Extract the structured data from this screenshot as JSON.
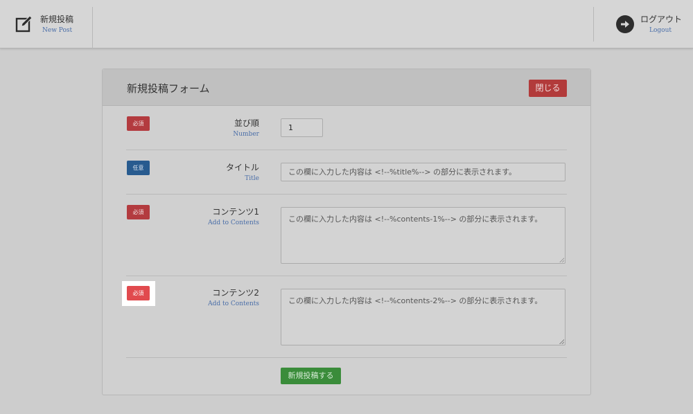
{
  "header": {
    "new_post": {
      "title": "新規投稿",
      "sub": "New Post",
      "icon": "edit-icon"
    },
    "logout": {
      "title": "ログアウト",
      "sub": "Logout",
      "icon": "arrow-right-circle-icon"
    }
  },
  "panel": {
    "title": "新規投稿フォーム",
    "close_label": "閉じる",
    "submit_label": "新規投稿する"
  },
  "fields": [
    {
      "badge": "必須",
      "label": "並び順",
      "sub": "Number",
      "value": "1"
    },
    {
      "badge": "任意",
      "label": "タイトル",
      "sub": "Title",
      "placeholder": "この欄に入力した内容は <!--%title%--> の部分に表示されます。"
    },
    {
      "badge": "必須",
      "label": "コンテンツ1",
      "sub": "Add to Contents",
      "placeholder": "この欄に入力した内容は <!--%contents-1%--> の部分に表示されます。"
    },
    {
      "badge": "必須",
      "label": "コンテンツ2",
      "sub": "Add to Contents",
      "placeholder": "この欄に入力した内容は <!--%contents-2%--> の部分に表示されます。"
    }
  ],
  "colors": {
    "required": "#b33b3f",
    "optional": "#285b8f",
    "submit": "#3a8c3a",
    "close": "#b23b3b",
    "highlight_badge": "#e14a4e"
  }
}
